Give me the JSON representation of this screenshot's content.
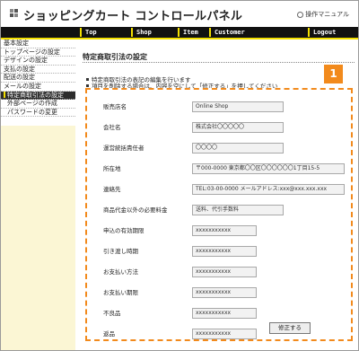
{
  "header": {
    "title": "ショッピングカート コントロールパネル",
    "manual_link": "操作マニュアル"
  },
  "navbar": {
    "items": [
      "Top",
      "Shop",
      "Item",
      "Customer"
    ],
    "logout": "Logout"
  },
  "sidebar": {
    "items": [
      {
        "label": "基本設定"
      },
      {
        "label": "トップページの設定"
      },
      {
        "label": "デザインの設定"
      },
      {
        "label": "支払の設定"
      },
      {
        "label": "配送の設定"
      },
      {
        "label": "メールの設定"
      },
      {
        "label": "特定商取引法の設定"
      },
      {
        "label": "外部ページの作成"
      },
      {
        "label": "パスワードの変更"
      }
    ]
  },
  "main": {
    "title": "特定商取引法の設定",
    "notes": [
      "特定商取引法の表記の編集を行います",
      "項目を削除する場合は、内容を空にして「修正する」を押してください"
    ],
    "badge": "1",
    "fields": [
      {
        "label": "販売店名",
        "value": "Online Shop"
      },
      {
        "label": "会社名",
        "value": "株式会社〇〇〇〇〇"
      },
      {
        "label": "運営統括責任者",
        "value": "〇〇〇〇"
      },
      {
        "label": "所在地",
        "value": "〒000-0000 東京都〇〇区〇〇〇〇〇〇1丁目15-5"
      },
      {
        "label": "連絡先",
        "value": "TEL:03-00-0000 メールアドレス:xxx@xxx.xxx.xxx"
      },
      {
        "label": "商品代金以外の必要料金",
        "value": "送料、代引手数料"
      },
      {
        "label": "申込の有効期限",
        "value": "xxxxxxxxxxx"
      },
      {
        "label": "引き渡し時期",
        "value": "xxxxxxxxxxx"
      },
      {
        "label": "お支払い方法",
        "value": "xxxxxxxxxxx"
      },
      {
        "label": "お支払い期限",
        "value": "xxxxxxxxxxx"
      },
      {
        "label": "不良品",
        "value": "xxxxxxxxxxx"
      },
      {
        "label": "返品",
        "value": "xxxxxxxxxxx"
      }
    ],
    "submit_label": "修正する"
  }
}
